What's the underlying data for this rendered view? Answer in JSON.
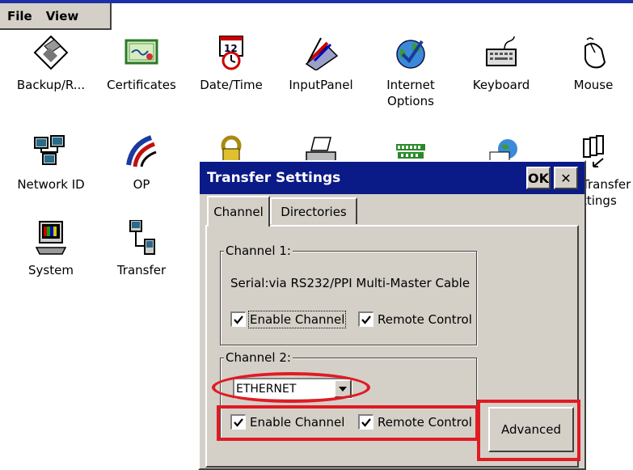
{
  "menu": {
    "file": "File",
    "view": "View"
  },
  "control_panel": {
    "items": [
      {
        "label": "Backup/R...",
        "icon": "floppy-disk-icon"
      },
      {
        "label": "Certificates",
        "icon": "certificate-icon"
      },
      {
        "label": "Date/Time",
        "icon": "calendar-clock-icon"
      },
      {
        "label": "InputPanel",
        "icon": "input-panel-icon"
      },
      {
        "label": "Internet",
        "label2": "Options",
        "icon": "globe-check-icon"
      },
      {
        "label": "Keyboard",
        "icon": "keyboard-icon"
      },
      {
        "label": "Mouse",
        "icon": "mouse-icon"
      },
      {
        "label": "Network ID",
        "icon": "network-computers-icon"
      },
      {
        "label": "OP",
        "icon": "op-swoosh-icon"
      },
      {
        "label": "",
        "icon": "password-keys-icon"
      },
      {
        "label": "",
        "icon": "printer-icon"
      },
      {
        "label": "",
        "icon": "profinet-icon"
      },
      {
        "label": "",
        "icon": "regional-globe-icon"
      },
      {
        "label": "Transfer",
        "label2": "ttings",
        "icon": "transfer-settings-icon"
      },
      {
        "label": "System",
        "icon": "system-computer-icon"
      },
      {
        "label": "Transfer",
        "icon": "transfer-icon"
      }
    ]
  },
  "dialog": {
    "title": "Transfer Settings",
    "ok": "OK",
    "close": "✕",
    "tabs": [
      {
        "label": "Channel"
      },
      {
        "label": "Directories"
      }
    ],
    "channel1": {
      "title": "Channel 1:",
      "description": "Serial:via RS232/PPI Multi-Master Cable",
      "enable_label": "Enable Channel",
      "remote_label": "Remote Control"
    },
    "channel2": {
      "title": "Channel 2:",
      "selected": "ETHERNET",
      "enable_label": "Enable Channel",
      "remote_label": "Remote Control"
    },
    "advanced": "Advanced"
  },
  "colors": {
    "title_bar": "#0a1a86",
    "highlight": "#e01b24",
    "face": "#d4d0c8"
  }
}
